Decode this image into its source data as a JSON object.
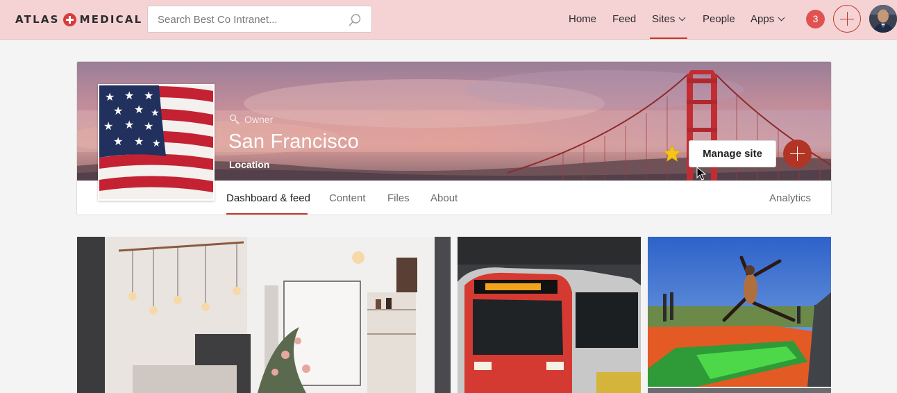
{
  "brand": {
    "left": "ATLAS",
    "right": "MEDICAL",
    "accent": "#d83b3b"
  },
  "search": {
    "placeholder": "Search Best Co Intranet..."
  },
  "nav": {
    "items": [
      {
        "label": "Home"
      },
      {
        "label": "Feed"
      },
      {
        "label": "Sites",
        "has_dropdown": true,
        "active": true
      },
      {
        "label": "People"
      },
      {
        "label": "Apps",
        "has_dropdown": true
      }
    ]
  },
  "notifications": {
    "count": "3"
  },
  "site": {
    "role": "Owner",
    "title": "San Francisco",
    "subtitle": "Location",
    "manage_label": "Manage site",
    "favorite": true
  },
  "tabs": [
    {
      "label": "Dashboard & feed",
      "active": true
    },
    {
      "label": "Content"
    },
    {
      "label": "Files"
    },
    {
      "label": "About"
    },
    {
      "label": "Analytics"
    }
  ],
  "colors": {
    "topbar_bg": "#f5d3d4",
    "active_underline": "#c0392b",
    "notification_badge": "#e05252",
    "site_plus": "#b23424",
    "star": "#f5c518"
  }
}
